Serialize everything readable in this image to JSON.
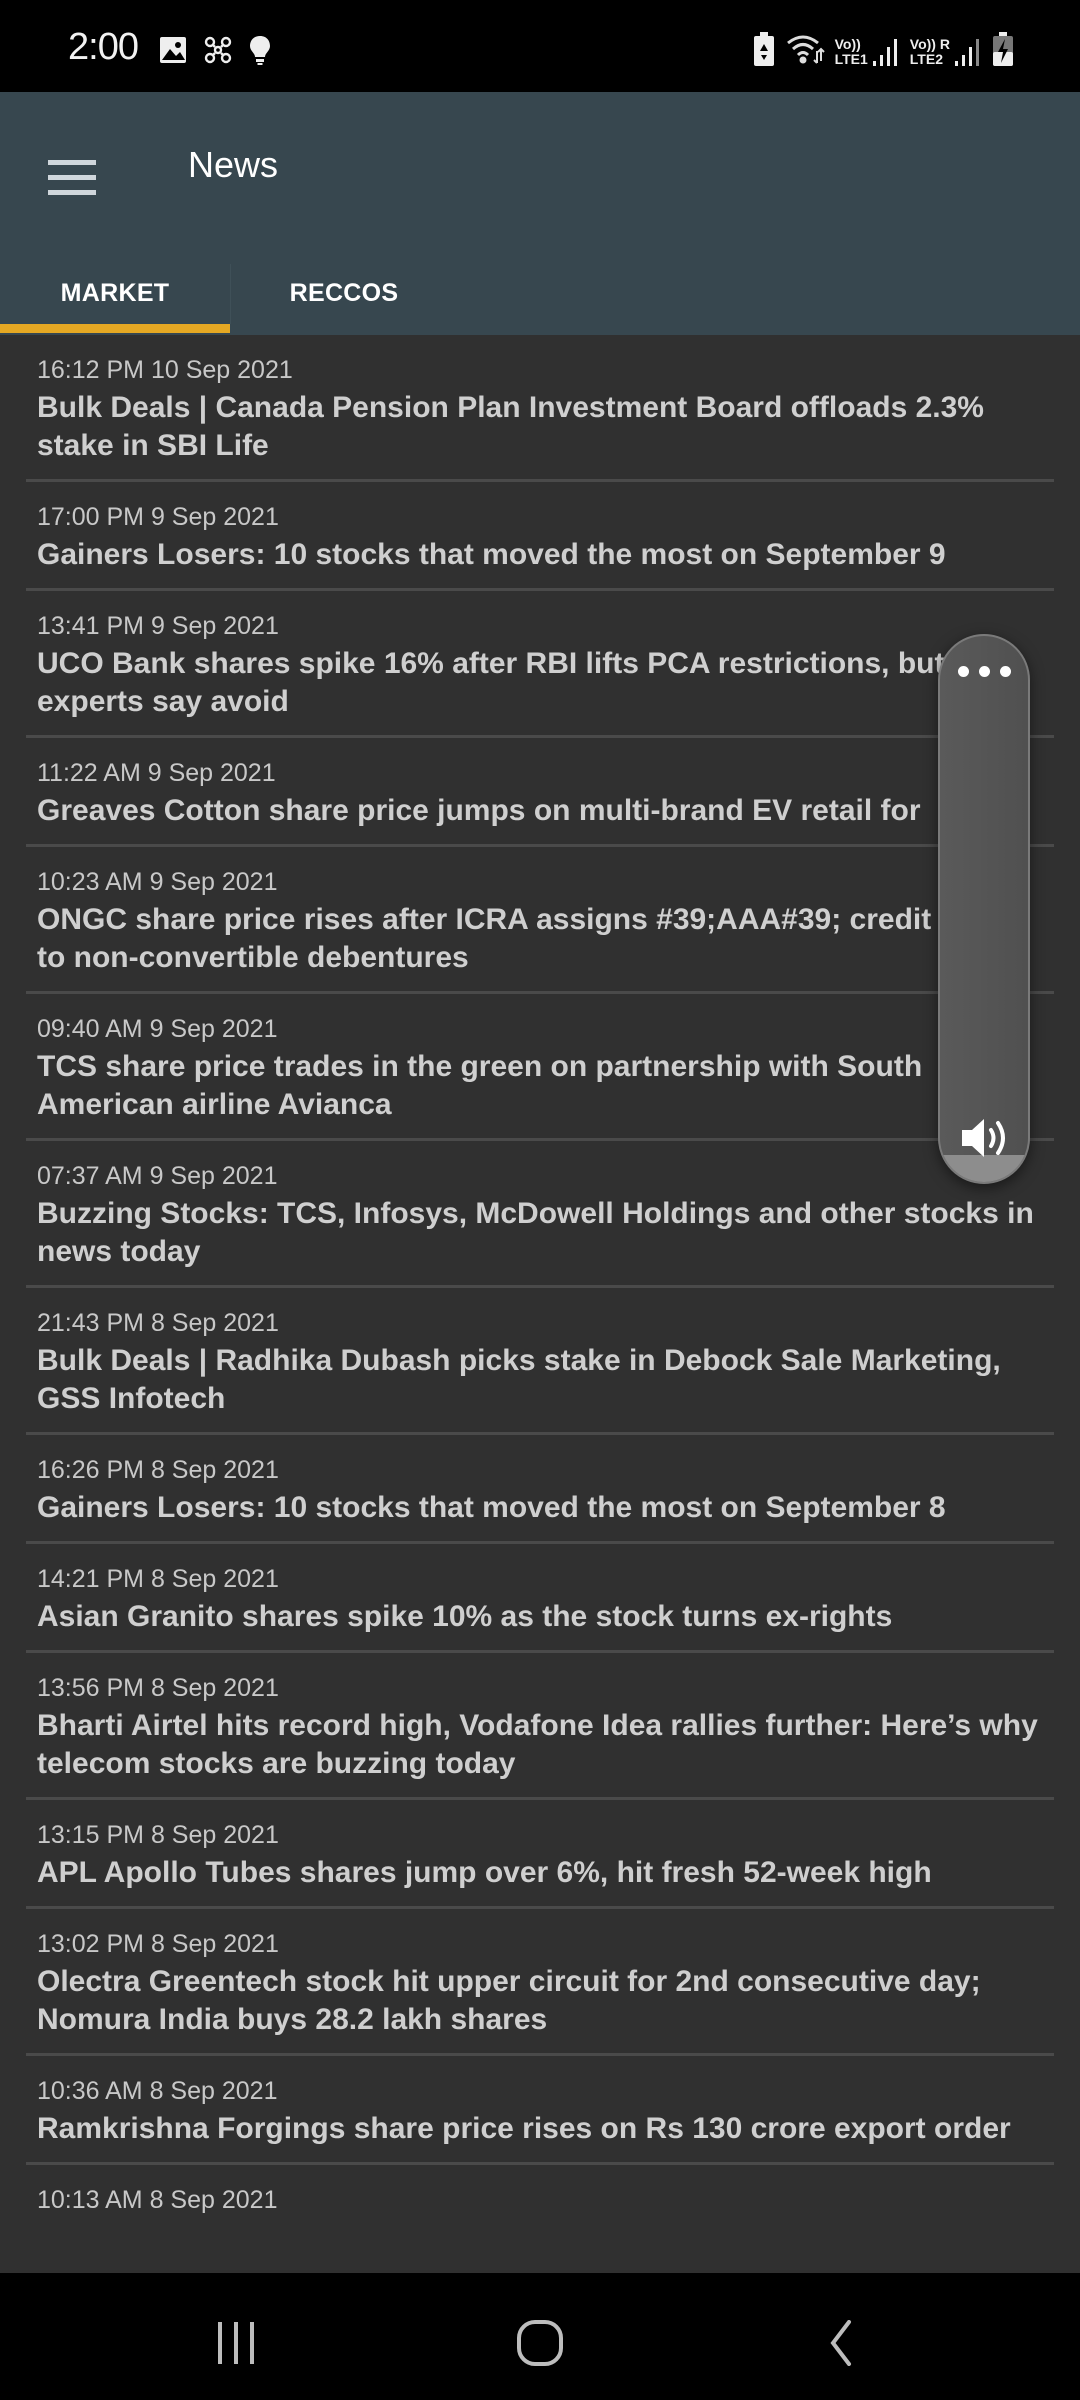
{
  "status_bar": {
    "time": "2:00",
    "left_icons": [
      "image-notification-icon",
      "fan-notification-icon",
      "bulb-notification-icon"
    ],
    "right_icons": [
      "battery-saver-icon",
      "wifi-icon",
      "lte1-signal-icon",
      "lte2-signal-icon",
      "battery-charging-icon"
    ],
    "sim1_label_top": "Vo))",
    "sim1_label_bottom": "LTE1",
    "sim2_label_top": "Vo))",
    "sim2_label_bottom": "LTE2",
    "roaming_label": "R"
  },
  "app_bar": {
    "title": "News",
    "menu_icon": "hamburger-menu-icon"
  },
  "tabs": [
    {
      "label": "MARKET",
      "active": true
    },
    {
      "label": "RECCOS",
      "active": false
    }
  ],
  "colors": {
    "app_bar": "#37474f",
    "tab_indicator": "#e5a823",
    "list_background": "#303030",
    "divider": "#4a4a4a"
  },
  "news": [
    {
      "time": "16:12 PM 10 Sep 2021",
      "title": "Bulk Deals | Canada Pension Plan Investment Board offloads 2.3% stake in SBI Life"
    },
    {
      "time": "17:00 PM 9 Sep 2021",
      "title": "Gainers  Losers: 10 stocks that moved the most on September 9"
    },
    {
      "time": "13:41 PM 9 Sep 2021",
      "title": "UCO Bank shares spike 16% after RBI lifts PCA restrictions, but experts say avoid"
    },
    {
      "time": "11:22 AM 9 Sep 2021",
      "title": "Greaves Cotton share price jumps on multi-brand EV retail for"
    },
    {
      "time": "10:23 AM 9 Sep 2021",
      "title": "ONGC share price rises after ICRA assigns #39;AAA#39; credit rating to non-convertible debentures"
    },
    {
      "time": "09:40 AM 9 Sep 2021",
      "title": "TCS share price trades in the green on partnership with South American airline Avianca"
    },
    {
      "time": "07:37 AM 9 Sep 2021",
      "title": "Buzzing Stocks: TCS, Infosys, McDowell Holdings and other stocks in news today"
    },
    {
      "time": "21:43 PM 8 Sep 2021",
      "title": "Bulk Deals | Radhika Dubash picks stake in Debock Sale Marketing, GSS Infotech"
    },
    {
      "time": "16:26 PM 8 Sep 2021",
      "title": "Gainers  Losers: 10 stocks that moved the most on September 8"
    },
    {
      "time": "14:21 PM 8 Sep 2021",
      "title": "Asian Granito shares spike 10% as the stock turns ex-rights"
    },
    {
      "time": "13:56 PM 8 Sep 2021",
      "title": "Bharti Airtel hits record high, Vodafone Idea rallies further: Here’s why telecom stocks are buzzing today"
    },
    {
      "time": "13:15 PM 8 Sep 2021",
      "title": "APL Apollo Tubes shares jump over 6%, hit fresh 52-week high"
    },
    {
      "time": "13:02 PM 8 Sep 2021",
      "title": "Olectra Greentech stock hit upper circuit for 2nd consecutive day; Nomura India buys 28.2 lakh shares"
    },
    {
      "time": "10:36 AM 8 Sep 2021",
      "title": "Ramkrishna Forgings share price rises on Rs 130 crore export order"
    },
    {
      "time": "10:13 AM 8 Sep 2021",
      "title": ""
    }
  ],
  "volume_overlay": {
    "level_fraction": 0.05,
    "more_icon": "more-options-icon",
    "speaker_icon": "speaker-volume-icon"
  },
  "nav_bar": {
    "buttons": [
      "recents-icon",
      "home-icon",
      "back-icon"
    ]
  }
}
